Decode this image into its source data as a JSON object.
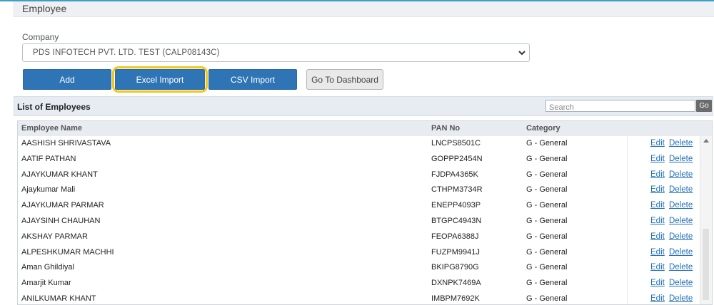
{
  "page": {
    "title": "Employee"
  },
  "company": {
    "label": "Company",
    "selected": "PDS INFOTECH PVT. LTD. TEST (CALP08143C)"
  },
  "actions": {
    "add": "Add",
    "excel_import": "Excel Import",
    "csv_import": "CSV Import",
    "dashboard": "Go To Dashboard"
  },
  "list": {
    "title": "List of Employees",
    "search_placeholder": "Search",
    "go": "Go",
    "columns": {
      "name": "Employee Name",
      "pan": "PAN No",
      "category": "Category"
    },
    "edit_label": "Edit",
    "delete_label": "Delete",
    "rows": [
      {
        "name": "AASHISH SHRIVASTAVA",
        "pan": "LNCPS8501C",
        "category": "G - General"
      },
      {
        "name": "AATIF PATHAN",
        "pan": "GOPPP2454N",
        "category": "G - General"
      },
      {
        "name": "AJAYKUMAR KHANT",
        "pan": "FJDPA4365K",
        "category": "G - General"
      },
      {
        "name": "Ajaykumar Mali",
        "pan": "CTHPM3734R",
        "category": "G - General"
      },
      {
        "name": "AJAYKUMAR PARMAR",
        "pan": "ENEPP4093P",
        "category": "G - General"
      },
      {
        "name": "AJAYSINH CHAUHAN",
        "pan": "BTGPC4943N",
        "category": "G - General"
      },
      {
        "name": "AKSHAY PARMAR",
        "pan": "FEOPA6388J",
        "category": "G - General"
      },
      {
        "name": "ALPESHKUMAR MACHHI",
        "pan": "FUZPM9941J",
        "category": "G - General"
      },
      {
        "name": "Aman Ghildiyal",
        "pan": "BKIPG8790G",
        "category": "G - General"
      },
      {
        "name": "Amarjit Kumar",
        "pan": "DXNPK7469A",
        "category": "G - General"
      },
      {
        "name": "ANILKUMAR KHANT",
        "pan": "IMBPM7692K",
        "category": "G - General"
      }
    ]
  },
  "colors": {
    "accent_blue": "#2f75b5",
    "highlight": "#f5c518",
    "link": "#1f6fb8"
  }
}
